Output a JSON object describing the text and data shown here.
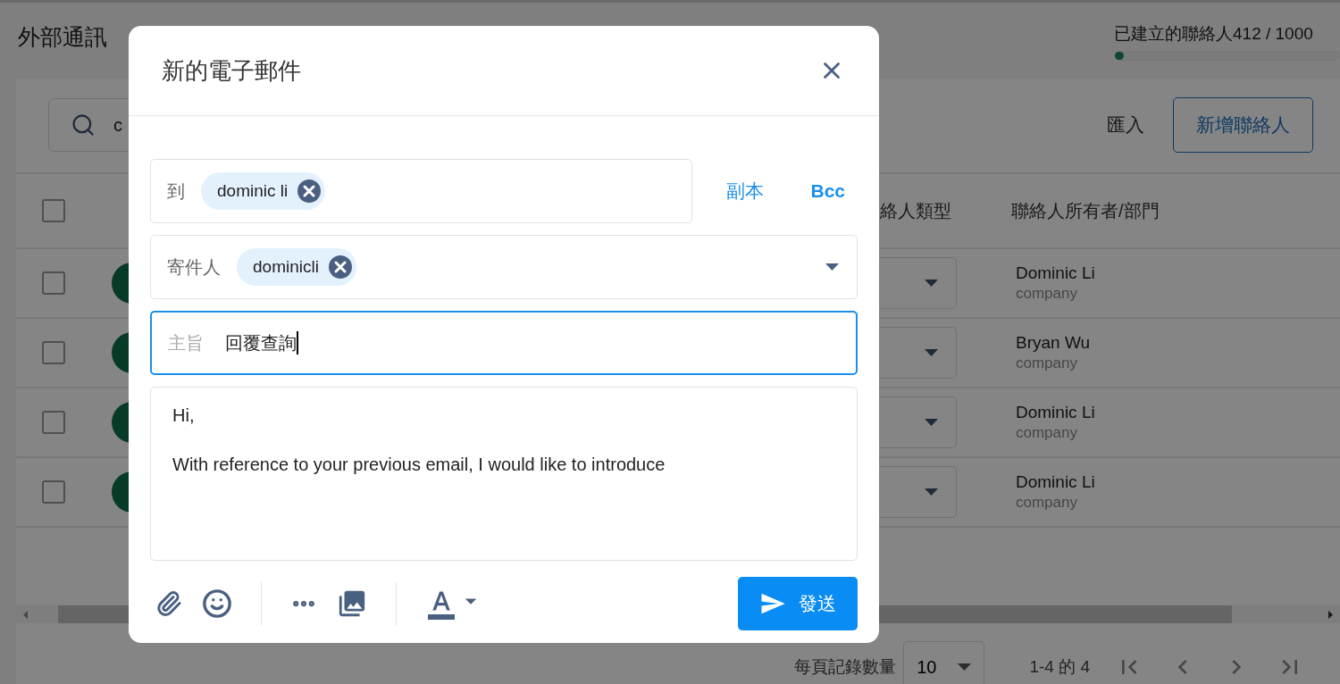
{
  "page": {
    "title": "外部通訊",
    "usage": {
      "label": "已建立的聯絡人412 / 1000",
      "level": 0.04
    }
  },
  "toolbar": {
    "search": {
      "value": "c"
    },
    "buttons": [
      {
        "label": "匯入",
        "kind": "text"
      },
      {
        "label": "新增聯絡人",
        "kind": "outlined"
      }
    ]
  },
  "table": {
    "header_checked": false,
    "columns": [
      {
        "label": "絡人類型"
      },
      {
        "label": "聯絡人所有者/部門"
      }
    ],
    "rows": [
      {
        "checked": false,
        "owner": "Dominic Li",
        "department": "company"
      },
      {
        "checked": false,
        "owner": "Bryan Wu",
        "department": "company"
      },
      {
        "checked": false,
        "owner": "Dominic Li",
        "department": "company"
      },
      {
        "checked": false,
        "owner": "Dominic Li",
        "department": "company"
      }
    ]
  },
  "pagination": {
    "rows_per_page_label": "每頁記錄數量",
    "rows_per_page": "10",
    "range": "1-4 的 4"
  },
  "dialog": {
    "title": "新的電子郵件",
    "to": {
      "label": "到",
      "chips": [
        "dominic li"
      ]
    },
    "copy_links": [
      "副本",
      "Bcc"
    ],
    "from": {
      "label": "寄件人",
      "chips": [
        "dominicli"
      ]
    },
    "subject": {
      "label": "主旨",
      "value": "回覆查詢",
      "focused": true
    },
    "body": [
      "Hi,",
      "With reference to your previous email, I would like to introduce"
    ],
    "send": "發送"
  }
}
